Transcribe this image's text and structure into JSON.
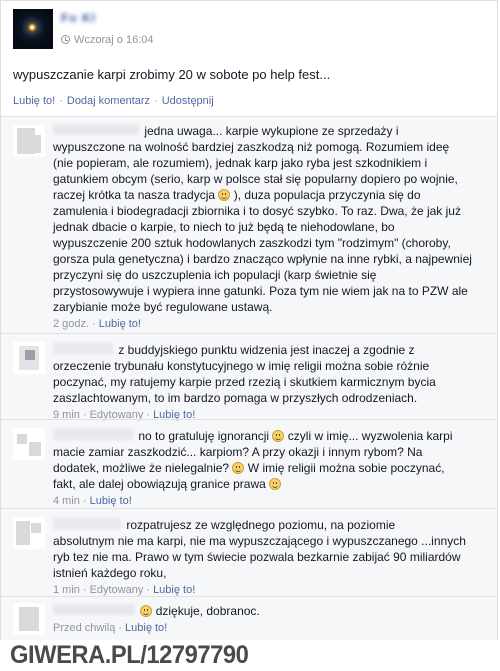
{
  "post": {
    "author": "Fo Kl",
    "time": "Wczoraj o 16:04",
    "text": "wypuszczanie karpi zrobimy 20 w sobote po help fest...",
    "actions": {
      "like": "Lubię to!",
      "comment": "Dodaj komentarz",
      "share": "Udostępnij"
    }
  },
  "comments": [
    {
      "name": "xxxxxxxxxxxxxxxxxxx",
      "lines": [
        "jedna uwaga... karpie wykupione ze sprzedaży i",
        "wypuszczone na wolność bardziej zaszkodzą niż pomogą. Rozumiem ideę",
        "(nie popieram, ale rozumiem), jednak karp jako ryba jest szkodnikiem i",
        "gatunkiem obcym (serio, karp w polsce stał się popularny dopiero po wojnie,",
        "raczej krótka ta nasza tradycja",
        "), duza populacja przyczynia się do",
        "zamulenia i biodegradacji zbiornika i to dosyć szybko. To raz. Dwa, że jak już",
        "jednak dbacie o karpie, to niech to już będą te niehodowlane, bo",
        "wypuszczenie 200 sztuk hodowlanych zaszkodzi tym \"rodzimym\" (choroby,",
        "gorsza pula genetyczna) i bardzo znacząco wpłynie na inne rybki, a najpewniej",
        "przyczyni się do uszczuplenia ich populacji (karp świetnie się",
        "przystosowywuje i wypiera inne gatunki. Poza tym nie wiem jak na to PZW ale",
        "zarybianie może być regulowane ustawą."
      ],
      "meta": {
        "time": "2 godz.",
        "like": "Lubię to!"
      }
    },
    {
      "name": "xxxxxxx",
      "lines": [
        "z buddyjskiego punktu widzenia jest inaczej a zgodnie z",
        "orzeczenie trybunału konstytucyjnego w imię religii można sobie różnie",
        "poczynać, my ratujemy karpie przed rzezią i skutkiem karmicznym bycia",
        "zaszlachtowanym, to im bardzo pomaga w przyszłych odrodzeniach."
      ],
      "meta": {
        "time": "9 min",
        "edited": "Edytowany",
        "like": "Lubię to!"
      }
    },
    {
      "name": "xxxxxxxxxxx",
      "lines": [
        "no to gratuluję ignorancji",
        "czyli w imię... wyzwolenia karpi",
        "macie zamiar zaszkodzić... karpiom? A przy okazji i innym rybom? Na",
        "dodatek, możliwe że nielegalnie?",
        "W imię religii można sobie poczynać,",
        "fakt, ale dalej obowiązują granice prawa"
      ],
      "meta": {
        "time": "4 min",
        "like": "Lubię to!"
      }
    },
    {
      "name": "xxxxxxxxxx",
      "lines": [
        "rozpatrujesz ze względnego poziomu, na poziomie",
        "absolutnym nie ma karpi, nie ma wypuszczającego i wypuszczanego ...innych",
        "ryb tez nie ma. Prawo w tym świecie pozwala bezkarnie zabijać 90 miliardów",
        "istnień każdego roku,"
      ],
      "meta": {
        "time": "1 min",
        "edited": "Edytowany",
        "like": "Lubię to!"
      }
    },
    {
      "name": "xxxxxxxxxxxxxxx",
      "lines": [
        "dziękuje, dobranoc."
      ],
      "meta": {
        "time": "Przed chwilą",
        "like": "Lubię to!"
      }
    }
  ],
  "watermark": "GIWERA.PL/12797790"
}
